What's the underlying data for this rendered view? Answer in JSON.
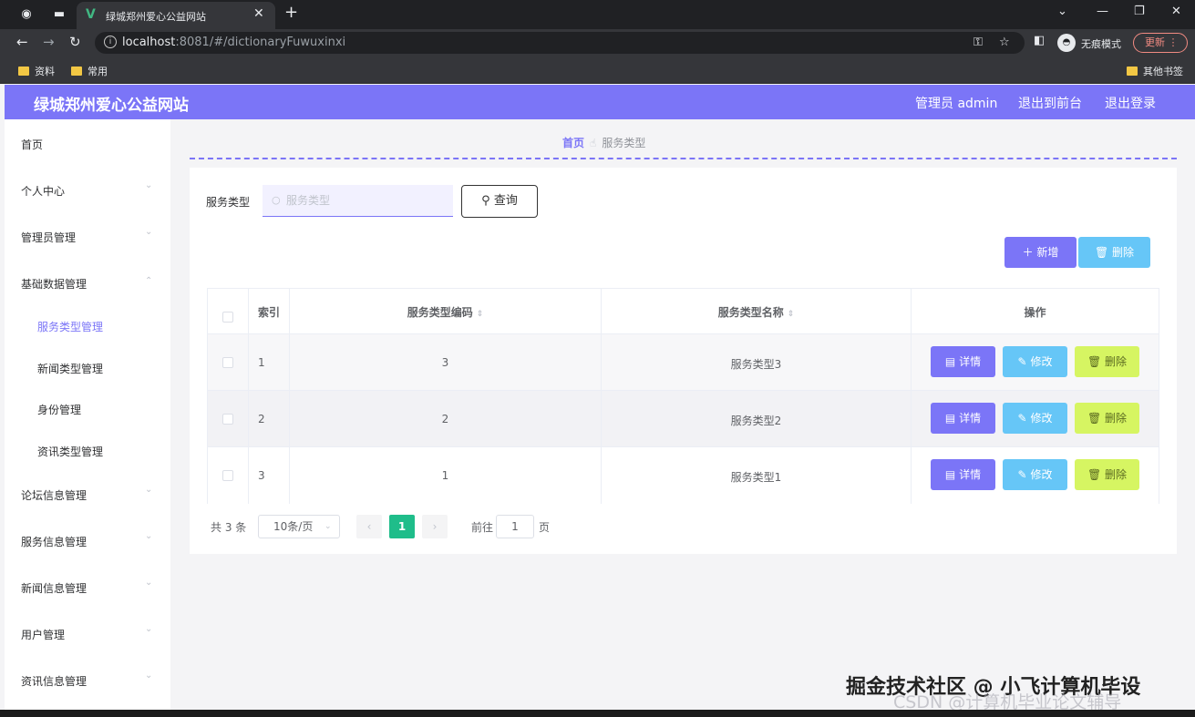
{
  "browser": {
    "tab_title": "绿城郑州爱心公益网站",
    "url_host": "localhost",
    "url_path": ":8081/#/dictionaryFuwuxinxi",
    "incognito_label": "无痕模式",
    "update_label": "更新",
    "bookmarks": [
      "资料",
      "常用"
    ],
    "other_bookmarks": "其他书签"
  },
  "header": {
    "title": "绿城郑州爱心公益网站",
    "admin": "管理员 admin",
    "to_front": "退出到前台",
    "logout": "退出登录"
  },
  "sidebar": {
    "items": [
      {
        "label": "首页"
      },
      {
        "label": "个人中心"
      },
      {
        "label": "管理员管理"
      },
      {
        "label": "基础数据管理"
      },
      {
        "label": "论坛信息管理"
      },
      {
        "label": "服务信息管理"
      },
      {
        "label": "新闻信息管理"
      },
      {
        "label": "用户管理"
      },
      {
        "label": "资讯信息管理"
      }
    ],
    "sub_items": [
      {
        "label": "服务类型管理"
      },
      {
        "label": "新闻类型管理"
      },
      {
        "label": "身份管理"
      },
      {
        "label": "资讯类型管理"
      }
    ]
  },
  "breadcrumb": {
    "home": "首页",
    "current": "服务类型"
  },
  "search": {
    "label": "服务类型",
    "placeholder": "服务类型",
    "button": "查询"
  },
  "actions": {
    "add": "新增",
    "delete": "删除"
  },
  "table": {
    "headers": {
      "index": "索引",
      "code": "服务类型编码",
      "name": "服务类型名称",
      "ops": "操作"
    },
    "rows": [
      {
        "index": "1",
        "code": "3",
        "name": "服务类型3"
      },
      {
        "index": "2",
        "code": "2",
        "name": "服务类型2"
      },
      {
        "index": "3",
        "code": "1",
        "name": "服务类型1"
      }
    ],
    "op_labels": {
      "detail": "详情",
      "edit": "修改",
      "delete": "删除"
    }
  },
  "pagination": {
    "total": "共 3 条",
    "page_size": "10条/页",
    "current": "1",
    "goto": "前往",
    "goto_value": "1",
    "page_unit": "页"
  },
  "watermark": {
    "line1": "掘金技术社区 @ 小飞计算机毕设",
    "line2": "CSDN @计算机毕业论文辅导"
  },
  "colors": {
    "accent": "#7b75f7",
    "info": "#66c6f7",
    "lime": "#d6f562",
    "page_active": "#1fbd8a"
  }
}
